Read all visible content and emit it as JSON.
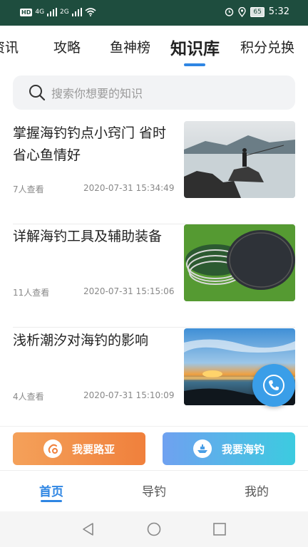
{
  "status_bar": {
    "left_badge": "HD",
    "network_1": "4G",
    "network_2": "2G",
    "battery": "65",
    "time": "5:32"
  },
  "top_tabs": [
    {
      "label": "资讯",
      "active": false
    },
    {
      "label": "攻略",
      "active": false
    },
    {
      "label": "鱼神榜",
      "active": false
    },
    {
      "label": "知识库",
      "active": true
    },
    {
      "label": "积分兑换",
      "active": false
    }
  ],
  "search": {
    "placeholder": "搜索你想要的知识",
    "icon": "search-icon"
  },
  "articles": [
    {
      "title": "掌握海钓钓点小窍门 省时省心鱼情好",
      "views": "7人查看",
      "time": "2020-07-31 15:34:49"
    },
    {
      "title": "详解海钓工具及辅助装备",
      "views": "11人查看",
      "time": "2020-07-31 15:15:06"
    },
    {
      "title": "浅析潮汐对海钓的影响",
      "views": "4人查看",
      "time": "2020-07-31 15:10:09"
    }
  ],
  "floating_button": {
    "icon": "phone-icon"
  },
  "actions": {
    "lure": {
      "label": "我要路亚",
      "icon": "lure-hook-icon"
    },
    "sea": {
      "label": "我要海钓",
      "icon": "boat-icon"
    }
  },
  "bottom_nav": [
    {
      "label": "首页",
      "active": true
    },
    {
      "label": "导钓",
      "active": false
    },
    {
      "label": "我的",
      "active": false
    }
  ],
  "colors": {
    "accent": "#2f86e3",
    "status_bar": "#1e4d3e",
    "lure_button": "#f0803c",
    "sea_button": "#3ccbe0"
  }
}
